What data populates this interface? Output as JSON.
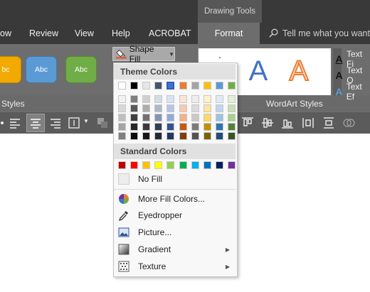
{
  "title_bar": {
    "context_group": "Drawing Tools"
  },
  "ribbon_tabs": [
    "ow",
    "Review",
    "View",
    "Help",
    "ACROBAT",
    "Format"
  ],
  "tell_me": "Tell me what you want",
  "group_labels": {
    "shape_styles": "Styles",
    "wordart_styles": "WordArt Styles"
  },
  "shape_style_buttons": [
    {
      "label": "bc",
      "color": "#f2a900"
    },
    {
      "label": "Abc",
      "color": "#5b9bd5"
    },
    {
      "label": "Abc",
      "color": "#70ad47"
    }
  ],
  "shape_fill": {
    "label": "Shape Fill",
    "accent": "#e7562b"
  },
  "wordart_options": [
    "Text Fi",
    "Text O",
    "Text Ef"
  ],
  "menu": {
    "theme_colors_title": "Theme Colors",
    "standard_colors_title": "Standard Colors",
    "theme_top": [
      "#ffffff",
      "#000000",
      "#e7e6e6",
      "#44546a",
      "#4472c4",
      "#ed7d31",
      "#a5a5a5",
      "#ffc000",
      "#5b9bd5",
      "#70ad47"
    ],
    "theme_shades": [
      [
        "#f2f2f2",
        "#7f7f7f",
        "#d0cece",
        "#d6dce4",
        "#d9e2f3",
        "#fbe5d5",
        "#ededed",
        "#fff2cc",
        "#deebf6",
        "#e2efd9"
      ],
      [
        "#d8d8d8",
        "#595959",
        "#aeabab",
        "#adb9ca",
        "#b4c6e7",
        "#f7cbac",
        "#dbdbdb",
        "#fee599",
        "#bdd7ee",
        "#c5e0b3"
      ],
      [
        "#bfbfbf",
        "#3f3f3f",
        "#757070",
        "#8496b0",
        "#8eaadb",
        "#f4b183",
        "#c9c9c9",
        "#ffd965",
        "#9cc3e5",
        "#a8d08d"
      ],
      [
        "#a5a5a5",
        "#262626",
        "#3a3838",
        "#323f4f",
        "#2f5496",
        "#c55a11",
        "#7b7b7b",
        "#bf9000",
        "#2e75b5",
        "#538135"
      ],
      [
        "#7f7f7f",
        "#0c0c0c",
        "#171616",
        "#222a35",
        "#1f3864",
        "#833c0b",
        "#525252",
        "#7f6000",
        "#1e4e79",
        "#375623"
      ]
    ],
    "standard": [
      "#c00000",
      "#ff0000",
      "#ffc000",
      "#ffff00",
      "#92d050",
      "#00b050",
      "#00b0f0",
      "#0070c0",
      "#002060",
      "#7030a0"
    ],
    "items": {
      "no_fill": "No Fill",
      "more_colors": "More Fill Colors...",
      "eyedropper": "Eyedropper",
      "picture": "Picture...",
      "gradient": "Gradient",
      "texture": "Texture"
    }
  }
}
